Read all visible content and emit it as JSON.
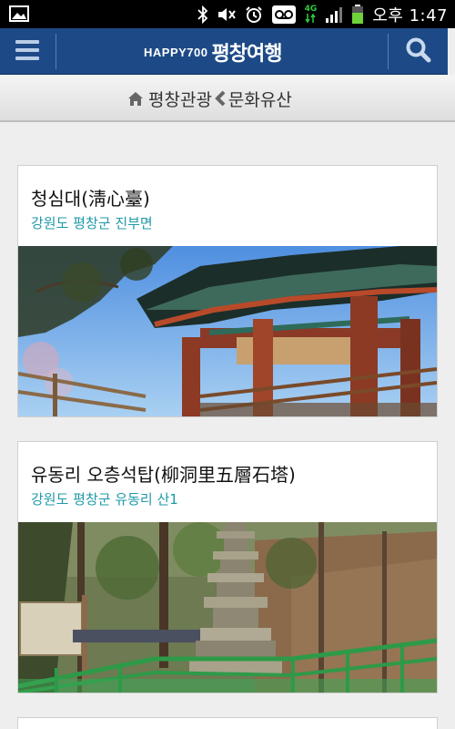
{
  "status_bar": {
    "network": "4G",
    "time": "오후 1:47",
    "icons": [
      "gallery-icon",
      "bluetooth-icon",
      "mute-icon",
      "alarm-icon",
      "voicemail-icon",
      "network-4g-icon",
      "signal-icon",
      "battery-icon"
    ]
  },
  "header": {
    "logo_brand": "HAPPY700",
    "logo_title": "평창여행",
    "icons": [
      "menu-icon",
      "search-icon"
    ]
  },
  "breadcrumb": {
    "root": "평창관광",
    "current": "문화유산",
    "icons": [
      "home-icon",
      "chevron-left-icon"
    ]
  },
  "cards": [
    {
      "title": "청심대(淸心臺)",
      "location": "강원도 평창군 진부면",
      "photo": "pavilion-photo"
    },
    {
      "title": "유동리 오층석탑(柳洞里五層石塔)",
      "location": "강원도 평창군 유동리 산1",
      "photo": "stone-pagoda-photo"
    }
  ],
  "colors": {
    "header_bg": "#1d4a86",
    "location_text": "#1e9aa8",
    "page_bg": "#eeeeee"
  }
}
